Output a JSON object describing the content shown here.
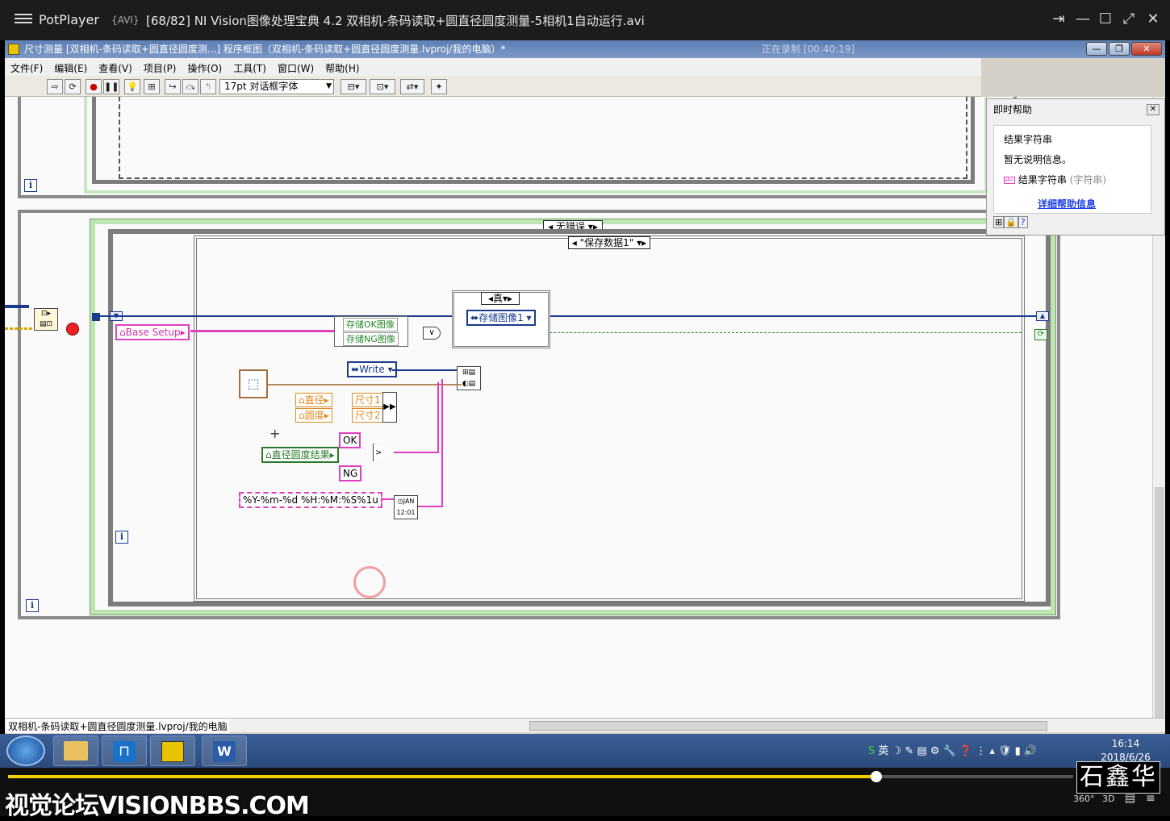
{
  "player": {
    "app_name": "PotPlayer",
    "format": "{AVI}",
    "file_title": "[68/82] NI Vision图像处理宝典 4.2 双相机-条码读取+圆直径圆度测量-5相机1自动运行.avi",
    "buttons": [
      "pin-icon",
      "minimize-icon",
      "maximize-icon",
      "fullscreen-icon",
      "close-icon"
    ]
  },
  "labview": {
    "window_title": "尺寸测量 [双相机-条码读取+圆直径圆度测...] 程序框图（双相机-条码读取+圆直径圆度测量.lvproj/我的电脑）*",
    "recording": "正在录制 [00:40:19]",
    "menu": [
      "文件(F)",
      "编辑(E)",
      "查看(V)",
      "项目(P)",
      "操作(O)",
      "工具(T)",
      "窗口(W)",
      "帮助(H)"
    ],
    "font_selector": "17pt 对话框字体",
    "project_path": "双相机-条码读取+圆直径圆度测量.lvproj/我的电脑",
    "diagram": {
      "case_no_error": "无错误",
      "case_save_data": "\"保存数据1\"",
      "case_true": "真",
      "iteration_label": "i",
      "base_setup": "Base Setup",
      "save_ok": "存储OK图像",
      "save_ng": "存储NG图像",
      "save_image": "存储图像1",
      "write": "Write",
      "diameter": "直径",
      "roundness": "圆度",
      "size1": "尺寸1",
      "size2": "尺寸2",
      "ok": "OK",
      "ng": "NG",
      "result": "直径圆度结果",
      "time_format": "%Y-%m-%d %H:%M:%S%1u"
    }
  },
  "help": {
    "title": "即时帮助",
    "heading": "结果字符串",
    "description": "暂无说明信息。",
    "terminal": "结果字符串",
    "terminal_type": "(字符串)",
    "link": "详细帮助信息"
  },
  "taskbar": {
    "time": "16:14",
    "date": "2018/6/26",
    "ime": "英"
  },
  "controls": {
    "progress": 0.815,
    "watermark": "视觉论坛VISIONBBS.COM",
    "author_seal": "石鑫华",
    "badges": [
      "360°",
      "3D"
    ]
  }
}
